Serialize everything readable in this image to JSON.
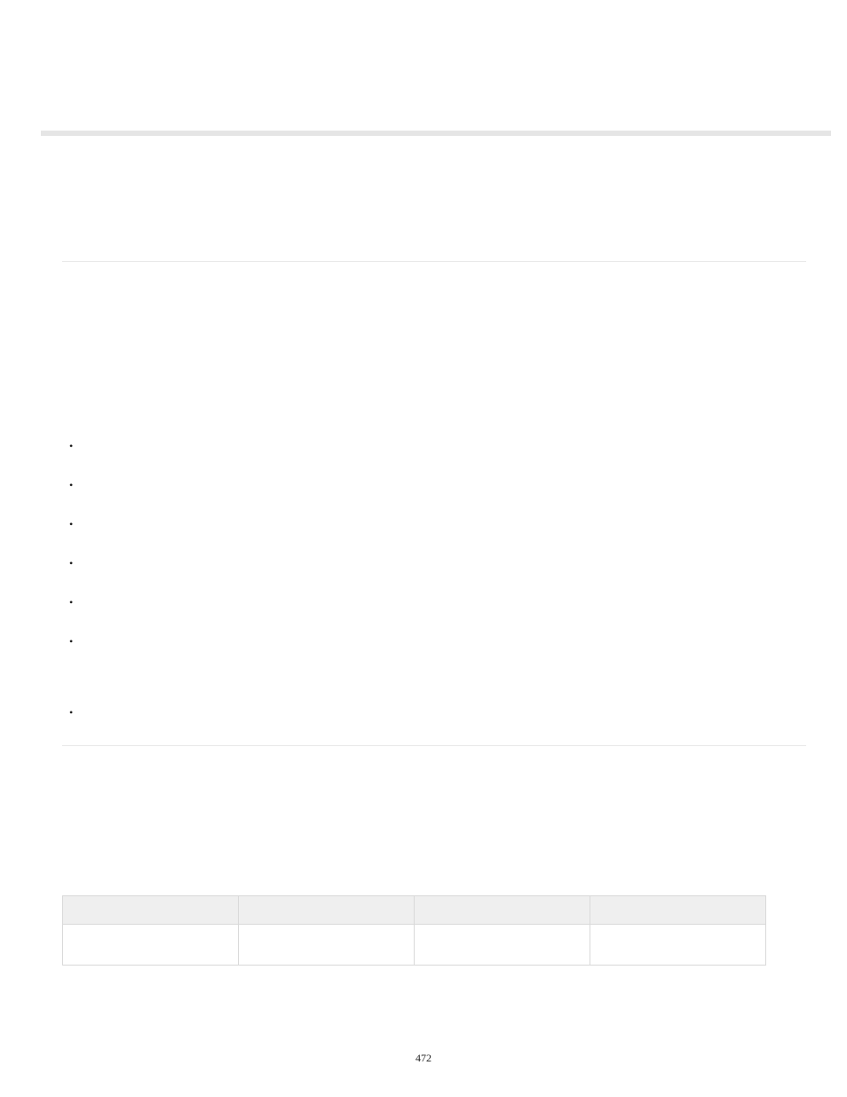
{
  "page_number": "472",
  "bullets": {
    "items": [
      "",
      "",
      "",
      "",
      "",
      "",
      ""
    ]
  },
  "table": {
    "headers": [
      "",
      "",
      "",
      ""
    ],
    "rows": [
      [
        "",
        "",
        "",
        ""
      ]
    ]
  }
}
